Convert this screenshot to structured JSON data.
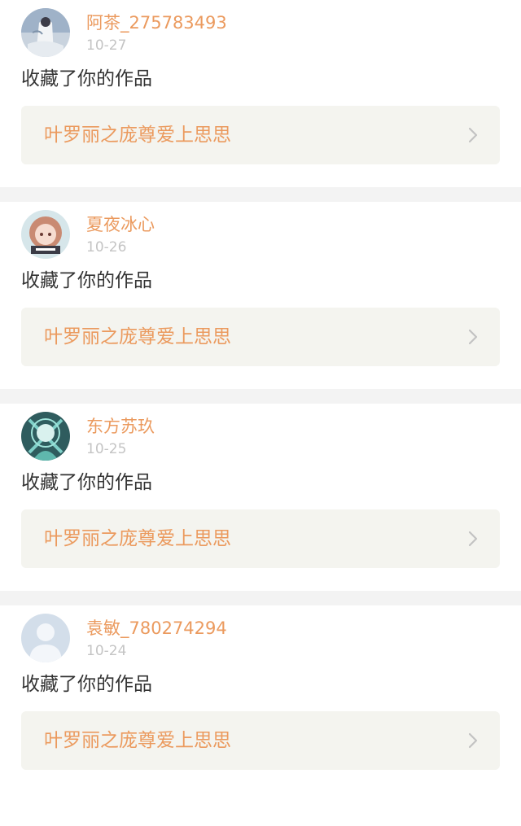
{
  "notifications": [
    {
      "username": "阿茶_275783493",
      "date": "10-27",
      "action": "收藏了你的作品",
      "work_title": "叶罗丽之庞尊爱上思思",
      "avatar_icon": "anime-avatar-white-dress"
    },
    {
      "username": "夏夜冰心",
      "date": "10-26",
      "action": "收藏了你的作品",
      "work_title": "叶罗丽之庞尊爱上思思",
      "avatar_icon": "anime-avatar-brown-hair"
    },
    {
      "username": "东方苏玖",
      "date": "10-25",
      "action": "收藏了你的作品",
      "work_title": "叶罗丽之庞尊爱上思思",
      "avatar_icon": "anime-avatar-teal"
    },
    {
      "username": "袁敏_780274294",
      "date": "10-24",
      "action": "收藏了你的作品",
      "work_title": "叶罗丽之庞尊爱上思思",
      "avatar_icon": "default-avatar"
    }
  ],
  "colors": {
    "accent": "#eb9a5e",
    "link_bg": "#f4f4ef",
    "divider": "#f3f3f3",
    "date": "#c4c4c4",
    "text": "#333333"
  }
}
